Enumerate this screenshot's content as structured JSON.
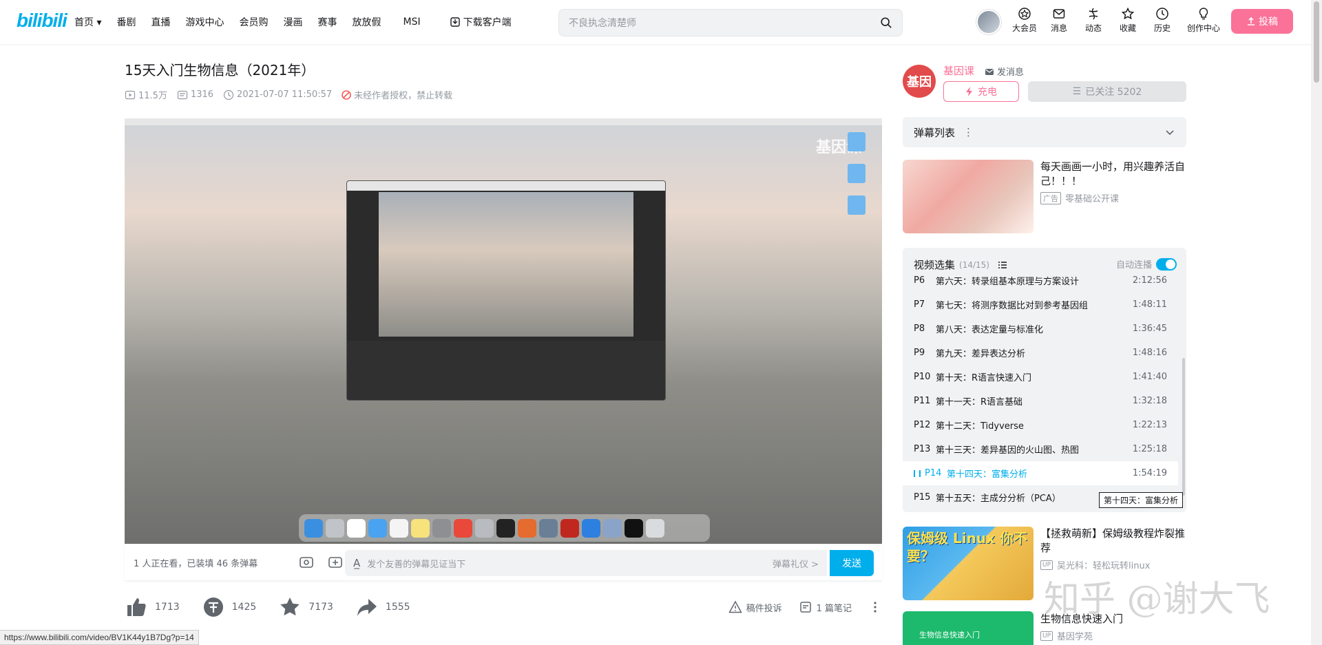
{
  "header": {
    "logo": "bilibili",
    "nav": [
      "首页 ▾",
      "番剧",
      "直播",
      "游戏中心",
      "会员购",
      "漫画",
      "赛事",
      "放放假",
      "MSI",
      "下载客户端"
    ],
    "search_placeholder": "不良执念清楚师",
    "icons": [
      {
        "icon": "vip-icon",
        "label": "大会员"
      },
      {
        "icon": "message-icon",
        "label": "消息"
      },
      {
        "icon": "dynamic-icon",
        "label": "动态"
      },
      {
        "icon": "star-icon",
        "label": "收藏"
      },
      {
        "icon": "history-icon",
        "label": "历史"
      },
      {
        "icon": "bulb-icon",
        "label": "创作中心"
      }
    ],
    "upload_label": "投稿"
  },
  "video": {
    "title": "15天入门生物信息（2021年）",
    "views": "11.5万",
    "danmaku_count": "1316",
    "date": "2021-07-07 11:50:57",
    "copyright": "未经作者授权，禁止转载",
    "watermark": "基因课"
  },
  "danmu": {
    "watching": "1 人正在看，已装填 46 条弹幕",
    "placeholder": "发个友善的弹幕见证当下",
    "etiquette": "弹幕礼仪 >",
    "send": "发送"
  },
  "actions": {
    "like": "1713",
    "coin": "1425",
    "fav": "7173",
    "share": "1555",
    "report": "稿件投诉",
    "notes": "1 篇笔记"
  },
  "status_url": "https://www.bilibili.com/video/BV1K44y1B7Dg?p=14",
  "uploader": {
    "avatar_text": "基因",
    "name": "基因课",
    "message": "发消息",
    "charge": "充电",
    "followed": "已关注 5202"
  },
  "danmaku_list": {
    "label": "弹幕列表"
  },
  "ad": {
    "title": "每天画画一小时，用兴趣养活自己！！！",
    "tag": "广告",
    "source": "零基础公开课"
  },
  "playlist": {
    "title": "视频选集",
    "count": "(14/15)",
    "autoplay": "自动连播",
    "items": [
      {
        "p": "P6",
        "name": "第六天：转录组基本原理与方案设计",
        "dur": "2:12:56"
      },
      {
        "p": "P7",
        "name": "第七天：将测序数据比对到参考基因组",
        "dur": "1:48:11"
      },
      {
        "p": "P8",
        "name": "第八天：表达定量与标准化",
        "dur": "1:36:45"
      },
      {
        "p": "P9",
        "name": "第九天：差异表达分析",
        "dur": "1:48:16"
      },
      {
        "p": "P10",
        "name": "第十天：R语言快速入门",
        "dur": "1:41:40"
      },
      {
        "p": "P11",
        "name": "第十一天：R语言基础",
        "dur": "1:32:18"
      },
      {
        "p": "P12",
        "name": "第十二天：Tidyverse",
        "dur": "1:22:13"
      },
      {
        "p": "P13",
        "name": "第十三天：差异基因的火山图、热图",
        "dur": "1:25:18"
      },
      {
        "p": "P14",
        "name": "第十四天：富集分析",
        "dur": "1:54:19"
      },
      {
        "p": "P15",
        "name": "第十五天：主成分分析（PCA）",
        "dur": ""
      }
    ],
    "tooltip": "第十四天：富集分析"
  },
  "recs": [
    {
      "thumb_text": "保姆级 Linux 你不要？",
      "title": "【拯救萌新】保姆级教程炸裂推荐",
      "source": "吴光科：轻松玩转linux"
    },
    {
      "thumb_text": "生物信息快速入门",
      "title": "生物信息快速入门",
      "source": "基因学苑"
    }
  ],
  "overlay_watermark": "知乎 @谢大飞"
}
